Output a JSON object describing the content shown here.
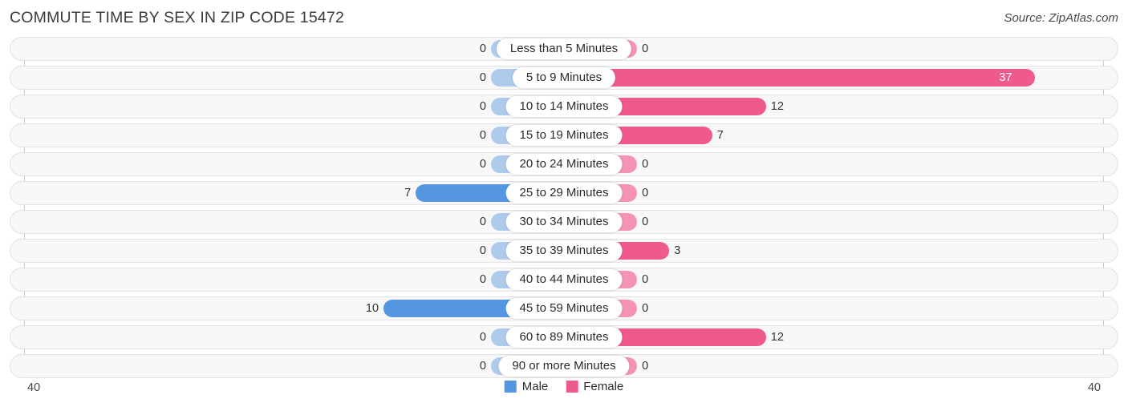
{
  "header": {
    "title": "COMMUTE TIME BY SEX IN ZIP CODE 15472",
    "source": "Source: ZipAtlas.com"
  },
  "legend": {
    "male_label": "Male",
    "female_label": "Female",
    "male_color": "#5596e0",
    "female_color": "#f05a8b"
  },
  "axis": {
    "left_end": "40",
    "right_end": "40"
  },
  "colors": {
    "male_strong": "#5596e0",
    "male_light": "#aecbec",
    "female_strong": "#f05a8b",
    "female_light": "#f593b5",
    "track_bg": "#f7f7f7",
    "track_border": "#e3e3e3"
  },
  "chart_data": {
    "type": "bar",
    "title": "COMMUTE TIME BY SEX IN ZIP CODE 15472",
    "xlabel": "",
    "ylabel": "",
    "orientation": "horizontal-diverging",
    "xlim": [
      40,
      40
    ],
    "grid": false,
    "legend_position": "bottom-center",
    "categories": [
      "Less than 5 Minutes",
      "5 to 9 Minutes",
      "10 to 14 Minutes",
      "15 to 19 Minutes",
      "20 to 24 Minutes",
      "25 to 29 Minutes",
      "30 to 34 Minutes",
      "35 to 39 Minutes",
      "40 to 44 Minutes",
      "45 to 59 Minutes",
      "60 to 89 Minutes",
      "90 or more Minutes"
    ],
    "series": [
      {
        "name": "Male",
        "values": [
          0,
          0,
          0,
          0,
          0,
          7,
          0,
          0,
          0,
          10,
          0,
          0
        ]
      },
      {
        "name": "Female",
        "values": [
          0,
          37,
          12,
          7,
          0,
          0,
          0,
          3,
          0,
          0,
          12,
          0
        ]
      }
    ]
  }
}
